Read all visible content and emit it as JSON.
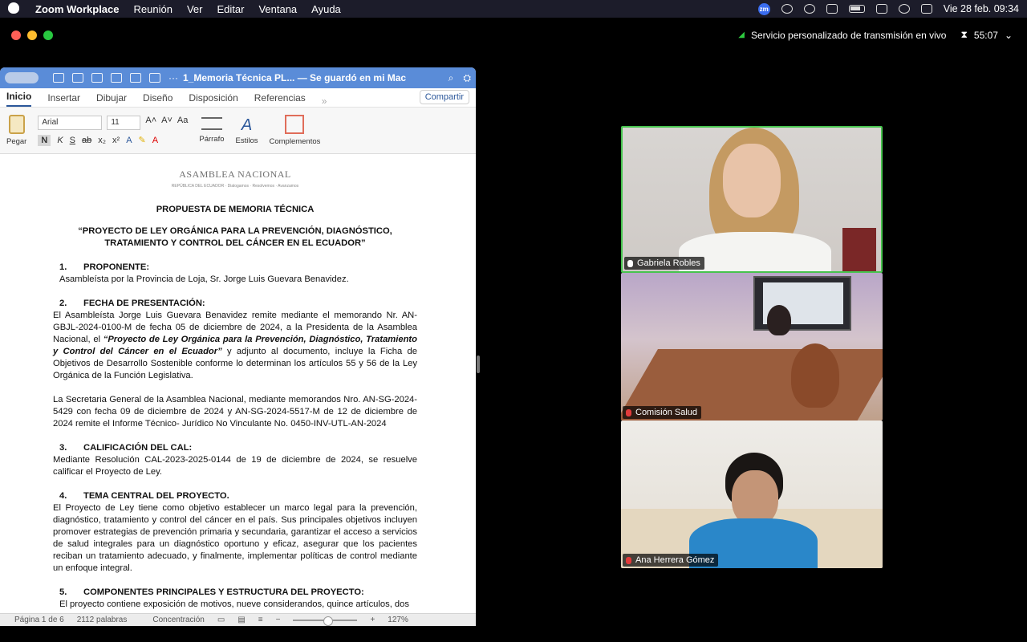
{
  "menubar": {
    "app": "Zoom Workplace",
    "items": [
      "Reunión",
      "Ver",
      "Editar",
      "Ventana",
      "Ayuda"
    ],
    "zoom_badge": "zm",
    "datetime": "Vie 28 feb.  09:34"
  },
  "meeting": {
    "live_label": "Servicio personalizado de transmisión en vivo",
    "timer": "55:07"
  },
  "word": {
    "doc_title": "1_Memoria Técnica PL... — Se guardó en mi Mac",
    "tabs": [
      "Inicio",
      "Insertar",
      "Dibujar",
      "Diseño",
      "Disposición",
      "Referencias"
    ],
    "share": "Compartir",
    "ribbon": {
      "paste": "Pegar",
      "font": "Arial",
      "size": "11",
      "paragraph": "Párrafo",
      "styles": "Estilos",
      "addins": "Complementos"
    },
    "document": {
      "logo": "ASAMBLEA NACIONAL",
      "logo_sub": "REPÚBLICA DEL ECUADOR · Dialogamos · Resolvemos · Avanzamos",
      "heading": "PROPUESTA DE MEMORIA TÉCNICA",
      "title": "“PROYECTO DE LEY ORGÁNICA PARA LA PREVENCIÓN, DIAGNÓSTICO, TRATAMIENTO Y CONTROL DEL CÁNCER EN EL ECUADOR”",
      "s1_num": "1.",
      "s1_title": "PROPONENTE:",
      "s1_text": "Asambleísta por la Provincia de Loja, Sr. Jorge Luis Guevara Benavidez.",
      "s2_num": "2.",
      "s2_title": "FECHA DE PRESENTACIÓN:",
      "s2_text_a": "El Asambleísta Jorge Luis Guevara Benavidez remite mediante el memorando Nr. AN-GBJL-2024-0100-M de fecha 05 de diciembre de 2024, a la Presidenta de la Asamblea Nacional, el ",
      "s2_text_b": "“Proyecto de Ley Orgánica para la Prevención, Diagnóstico, Tratamiento y Control del Cáncer en el Ecuador”",
      "s2_text_c": " y adjunto al documento, incluye la Ficha de Objetivos de Desarrollo Sostenible conforme lo determinan los artículos 55 y 56 de la Ley Orgánica de la Función Legislativa.",
      "s2_text_d": "La Secretaria General de la Asamblea Nacional, mediante memorandos Nro. AN-SG-2024-5429 con fecha 09 de diciembre de 2024 y AN-SG-2024-5517-M de 12 de diciembre de 2024 remite el Informe Técnico- Jurídico No Vinculante No. 0450-INV-UTL-AN-2024",
      "s3_num": "3.",
      "s3_title": "CALIFICACIÓN DEL CAL:",
      "s3_text": "Mediante Resolución CAL-2023-2025-0144 de 19 de diciembre de 2024, se resuelve calificar el Proyecto de Ley.",
      "s4_num": "4.",
      "s4_title": "TEMA CENTRAL DEL PROYECTO.",
      "s4_text": "El Proyecto de Ley tiene como objetivo establecer un marco legal para la prevención, diagnóstico, tratamiento y control del cáncer en el país. Sus principales objetivos incluyen promover estrategias de prevención primaria y secundaria, garantizar el acceso a servicios de salud integrales para un diagnóstico oportuno y eficaz, asegurar que los pacientes reciban un tratamiento adecuado, y finalmente, implementar políticas de control mediante un enfoque integral.",
      "s5_num": "5.",
      "s5_title": "COMPONENTES PRINCIPALES Y ESTRUCTURA DEL PROYECTO:",
      "s5_text": "El proyecto contiene exposición de motivos, nueve considerandos, quince artículos, dos"
    },
    "status": {
      "page": "Página 1 de 6",
      "words": "2112 palabras",
      "focus": "Concentración",
      "zoom": "127%"
    }
  },
  "participants": [
    {
      "name": "Gabriela Robles"
    },
    {
      "name": "Comisión Salud"
    },
    {
      "name": "Ana Herrera Gómez"
    }
  ],
  "colors": {
    "active_speaker": "#47c34e",
    "word_titlebar": "#5a8cd8",
    "muted": "#e23b3b"
  }
}
